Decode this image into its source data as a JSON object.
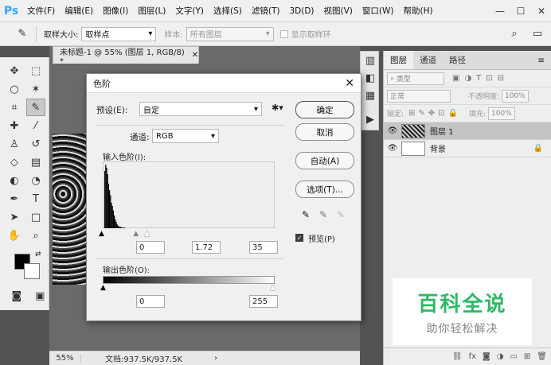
{
  "menubar": {
    "logo": "Ps",
    "items": [
      "文件(F)",
      "编辑(E)",
      "图像(I)",
      "图层(L)",
      "文字(Y)",
      "选择(S)",
      "滤镜(T)",
      "3D(D)",
      "视图(V)",
      "窗口(W)",
      "帮助(H)"
    ],
    "controls": [
      "—",
      "☐",
      "✕"
    ]
  },
  "options_bar": {
    "sample_size_label": "取样大小:",
    "sample_size_value": "取样点",
    "sample_label": "样本:",
    "sample_value": "所有图层",
    "show_ring_label": "显示取样环"
  },
  "document": {
    "tab_title": "未标题-1 @ 55% (图层 1, RGB/8) *",
    "zoom": "55%",
    "doc_info": "文档:937.5K/937.5K"
  },
  "dialog": {
    "title": "色阶",
    "preset_label": "预设(E):",
    "preset_value": "自定",
    "channel_label": "通道:",
    "channel_value": "RGB",
    "input_levels_label": "输入色阶(I):",
    "input_black": "0",
    "input_gamma": "1.72",
    "input_white": "35",
    "output_levels_label": "输出色阶(O):",
    "output_black": "0",
    "output_white": "255",
    "buttons": {
      "ok": "确定",
      "cancel": "取消",
      "auto": "自动(A)",
      "options": "选项(T)..."
    },
    "preview_label": "预览(P)"
  },
  "layers_panel": {
    "tabs": [
      "图层",
      "通道",
      "路径"
    ],
    "filter_label": "类型",
    "blend_mode": "正常",
    "opacity_label": "不透明度:",
    "opacity_value": "100%",
    "lock_label": "锁定:",
    "fill_label": "填充:",
    "fill_value": "100%",
    "layers": [
      {
        "name": "图层 1",
        "selected": true
      },
      {
        "name": "背景",
        "selected": false
      }
    ]
  },
  "watermark": {
    "title": "百科全说",
    "subtitle": "助你轻松解决"
  },
  "histogram": {
    "values": [
      90,
      100,
      95,
      85,
      70,
      60,
      52,
      40,
      35,
      28,
      20,
      14,
      10,
      6,
      4,
      3,
      2,
      2,
      1,
      1,
      1,
      1,
      0,
      0,
      0,
      0,
      0,
      0,
      0,
      0,
      0,
      0
    ],
    "input_black_pct": 0,
    "input_gamma_pct": 14,
    "input_white_pct": 14
  },
  "colors": {
    "ps_blue": "#31a8ff",
    "watermark_green": "#2fb866",
    "foreground": "#000000",
    "background": "#ffffff"
  }
}
